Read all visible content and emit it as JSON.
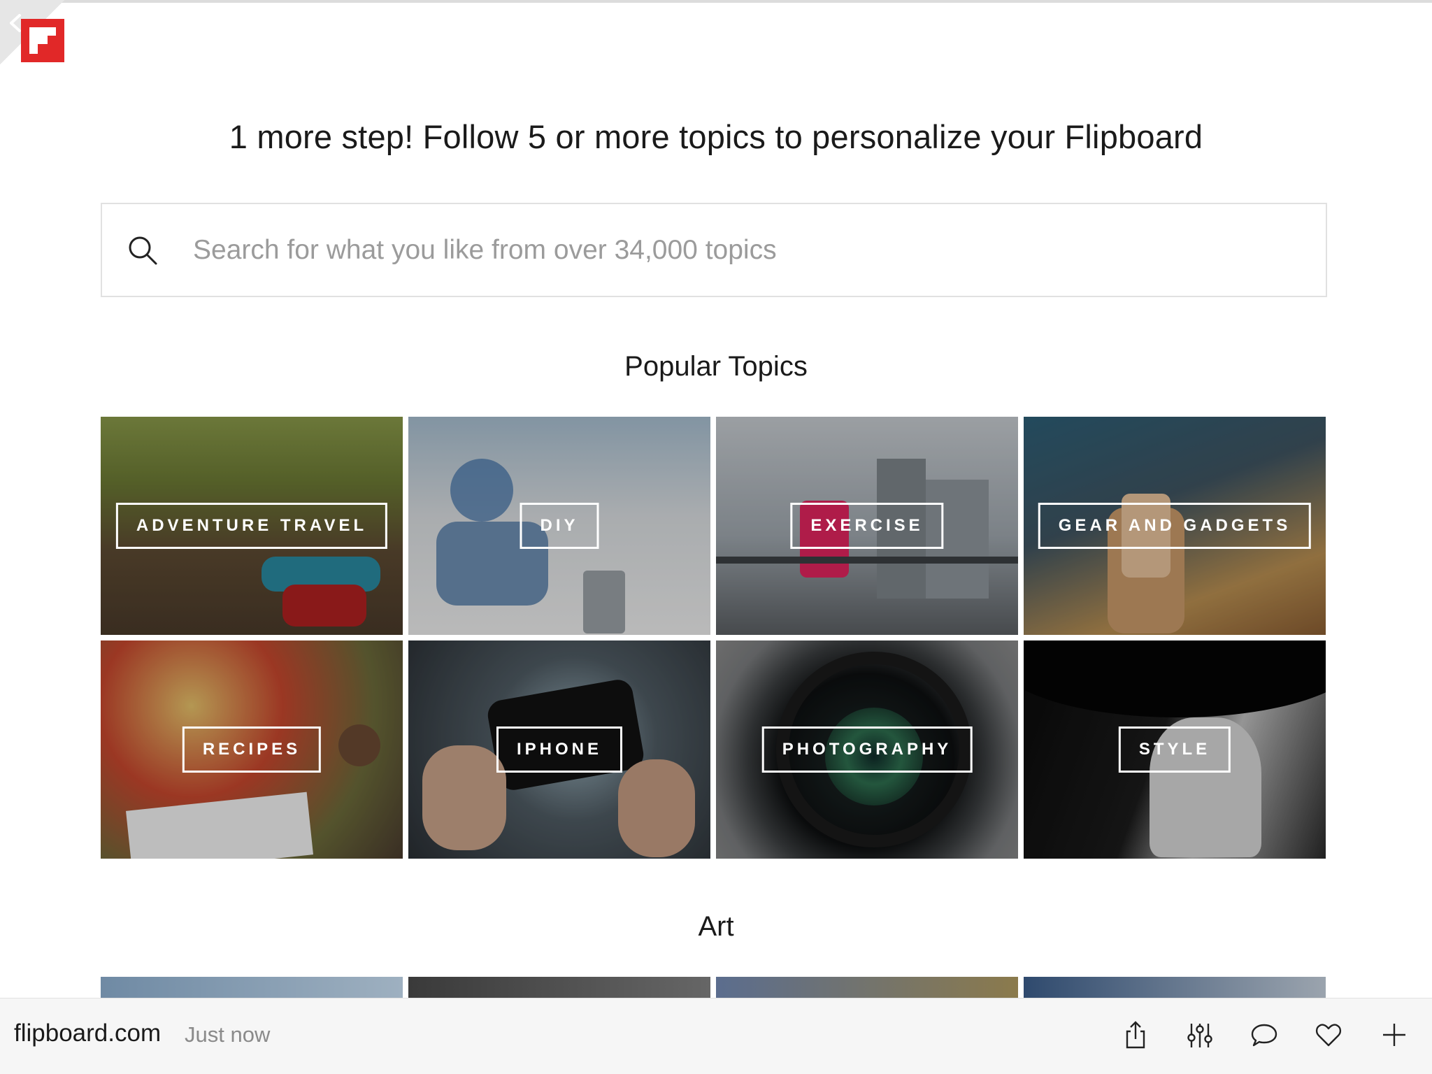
{
  "header": {
    "headline": "1 more step! Follow 5 or more topics to personalize your Flipboard"
  },
  "search": {
    "placeholder": "Search for what you like from over 34,000 topics",
    "value": ""
  },
  "sections": {
    "popular_title": "Popular Topics",
    "art_title": "Art"
  },
  "topics": [
    {
      "label": "ADVENTURE TRAVEL"
    },
    {
      "label": "DIY"
    },
    {
      "label": "EXERCISE"
    },
    {
      "label": "GEAR AND GADGETS"
    },
    {
      "label": "RECIPES"
    },
    {
      "label": "IPHONE"
    },
    {
      "label": "PHOTOGRAPHY"
    },
    {
      "label": "STYLE"
    }
  ],
  "bottom_bar": {
    "domain": "flipboard.com",
    "timestamp": "Just now",
    "icons": [
      "share-icon",
      "filter-sliders-icon",
      "comment-icon",
      "heart-icon",
      "plus-icon"
    ]
  },
  "colors": {
    "brand_red": "#e12828",
    "label_border": "#ffffff",
    "placeholder_gray": "#9b9b9b"
  }
}
